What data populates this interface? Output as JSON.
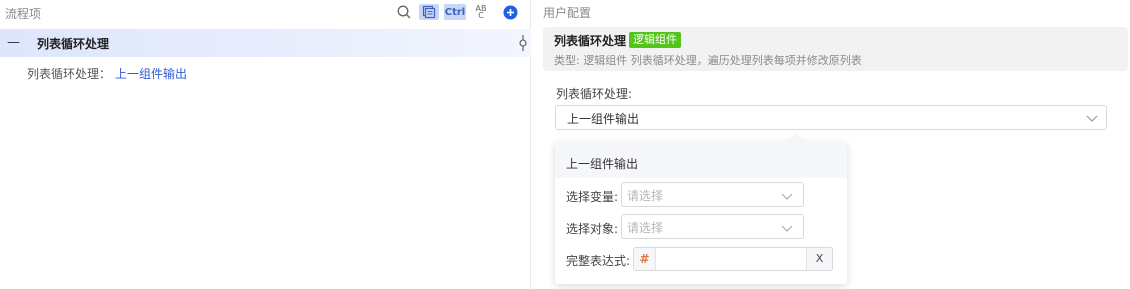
{
  "left_panel": {
    "title": "流程项",
    "toolbar": {
      "search_icon": "search-icon",
      "select_icon": "select-all-icon",
      "ctrl_label": "Ctrl",
      "abc_top": "AB",
      "abc_bottom": "C",
      "add_icon": "plus-circle-icon"
    },
    "tree": {
      "collapse_symbol": "—",
      "node_title": "列表循环处理",
      "detail_label": "列表循环处理：",
      "detail_value": "上一组件输出"
    }
  },
  "right_panel": {
    "title": "用户配置",
    "info": {
      "name": "列表循环处理",
      "tag": "逻辑组件",
      "desc_label": "类型:",
      "desc_text": "逻辑组件 列表循环处理，遍历处理列表每项并修改原列表"
    },
    "field_label": "列表循环处理:",
    "select_value": "上一组件输出",
    "dropdown": {
      "header": "上一组件输出",
      "var_label": "选择变量:",
      "var_placeholder": "请选择",
      "obj_label": "选择对象:",
      "obj_placeholder": "请选择",
      "expr_label": "完整表达式:",
      "expr_prefix": "#",
      "expr_clear": "X"
    }
  },
  "colors": {
    "accent_blue": "#2e5bd1",
    "tag_green": "#52c41a",
    "row_highlight": "#dde6fb",
    "hash_orange": "#e8743b"
  }
}
